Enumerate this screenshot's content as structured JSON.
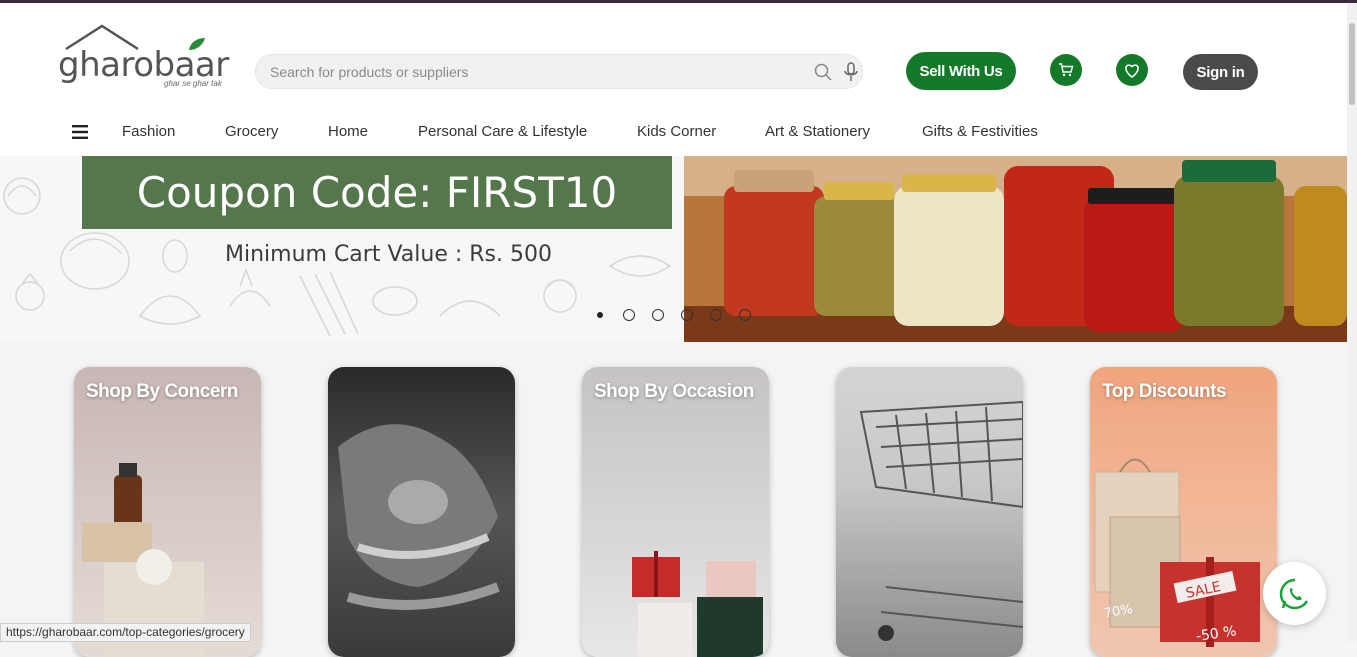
{
  "brand": {
    "name": "gharobaar",
    "tagline": "ghar se ghar tak"
  },
  "search": {
    "placeholder": "Search for products or suppliers"
  },
  "header": {
    "sell_label": "Sell With Us",
    "signin_label": "Sign in"
  },
  "nav": {
    "items": [
      "Fashion",
      "Grocery",
      "Home",
      "Personal Care & Lifestyle",
      "Kids Corner",
      "Art & Stationery",
      "Gifts & Festivities"
    ]
  },
  "banner": {
    "coupon": "Coupon Code: FIRST10",
    "min_cart": "Minimum Cart Value : Rs. 500",
    "slides": 6,
    "active_slide": 1
  },
  "cards": [
    {
      "title": "Shop By Concern"
    },
    {
      "title": ""
    },
    {
      "title": "Shop By Occasion"
    },
    {
      "title": ""
    },
    {
      "title": "Top Discounts"
    }
  ],
  "status_url": "https://gharobaar.com/top-categories/grocery",
  "colors": {
    "brand_green": "#147a2a",
    "coupon_green": "#54774b",
    "signin_gray": "#4a4a4a"
  }
}
